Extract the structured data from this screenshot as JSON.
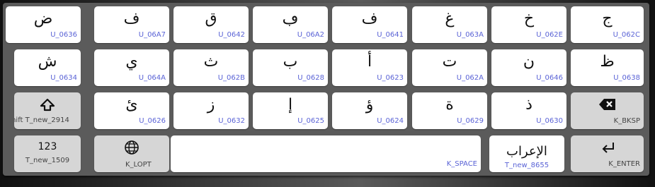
{
  "keyboard": {
    "row1": [
      {
        "glyph": "ض",
        "code": "U_0636"
      },
      {
        "glyph": "ف",
        "code": "U_06A7"
      },
      {
        "glyph": "ق",
        "code": "U_0642"
      },
      {
        "glyph": "ڢ",
        "code": "U_06A2"
      },
      {
        "glyph": "ف",
        "code": "U_0641"
      },
      {
        "glyph": "غ",
        "code": "U_063A"
      },
      {
        "glyph": "خ",
        "code": "U_062E"
      },
      {
        "glyph": "ج",
        "code": "U_062C"
      }
    ],
    "row2": [
      {
        "glyph": "ش",
        "code": "U_0634"
      },
      {
        "glyph": "ي",
        "code": "U_064A"
      },
      {
        "glyph": "ث",
        "code": "U_062B"
      },
      {
        "glyph": "ب",
        "code": "U_0628"
      },
      {
        "glyph": "أ",
        "code": "U_0623"
      },
      {
        "glyph": "ت",
        "code": "U_062A"
      },
      {
        "glyph": "ن",
        "code": "U_0646"
      },
      {
        "glyph": "ظ",
        "code": "U_0638"
      }
    ],
    "row3": [
      {
        "glyph": "ئ",
        "code": "U_0626"
      },
      {
        "glyph": "ز",
        "code": "U_0632"
      },
      {
        "glyph": "إ",
        "code": "U_0625"
      },
      {
        "glyph": "ؤ",
        "code": "U_0624"
      },
      {
        "glyph": "ة",
        "code": "U_0629"
      },
      {
        "glyph": "ذ",
        "code": "U_0630"
      }
    ],
    "shift": {
      "label": "hift T_new_2914",
      "icon": "shift-arrow-icon"
    },
    "backspace": {
      "label": "K_BKSP",
      "icon": "backspace-icon"
    },
    "numbers": {
      "label": "123",
      "code": "T_new_1509"
    },
    "lopt": {
      "label": "K_LOPT",
      "icon": "globe-icon"
    },
    "space": {
      "label": "K_SPACE"
    },
    "diacritics": {
      "label": "الإعراب",
      "code": "T_new_8655"
    },
    "enter": {
      "label": "K_ENTER",
      "icon": "enter-icon"
    }
  }
}
